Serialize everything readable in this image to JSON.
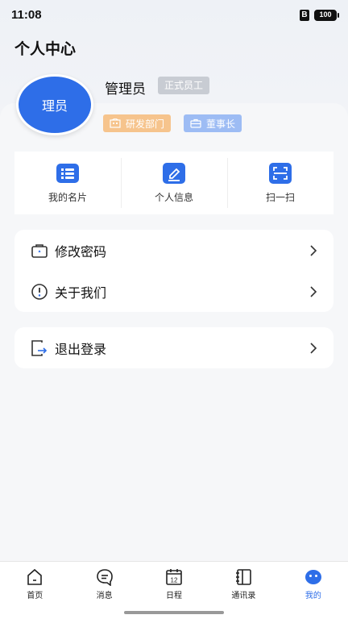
{
  "status_bar": {
    "time": "11:08",
    "sim_label": "B",
    "battery": "100"
  },
  "page_title": "个人中心",
  "profile": {
    "avatar_text": "理员",
    "name": "管理员",
    "employment_tag": "正式员工",
    "department": "研发部门",
    "position": "董事长"
  },
  "quick_actions": [
    {
      "label": "我的名片",
      "icon": "id-card-icon"
    },
    {
      "label": "个人信息",
      "icon": "edit-icon"
    },
    {
      "label": "扫一扫",
      "icon": "scan-icon"
    }
  ],
  "menu": {
    "change_password": "修改密码",
    "about_us": "关于我们",
    "logout": "退出登录"
  },
  "bottom_nav": [
    {
      "label": "首页",
      "icon": "home-icon"
    },
    {
      "label": "消息",
      "icon": "message-icon"
    },
    {
      "label": "日程",
      "icon": "calendar-icon",
      "calendar_day": "12"
    },
    {
      "label": "通讯录",
      "icon": "contacts-icon"
    },
    {
      "label": "我的",
      "icon": "profile-icon"
    }
  ],
  "colors": {
    "accent": "#2e6ee8",
    "dept_chip": "#f6c48d",
    "position_chip": "#9dbcf4",
    "tag_gray": "#c8ccd3"
  }
}
